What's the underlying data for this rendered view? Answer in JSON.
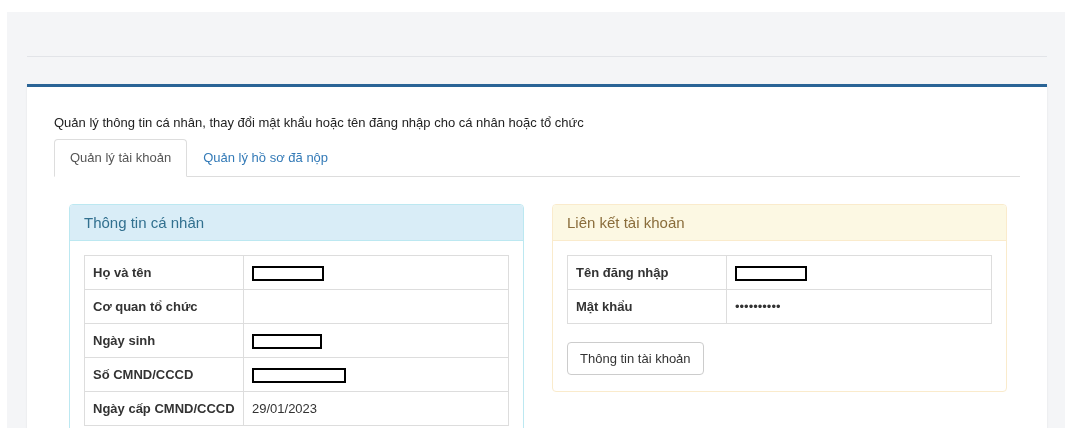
{
  "description": "Quản lý thông tin cá nhân, thay đổi mật khẩu hoặc tên đăng nhập cho cá nhân hoặc tổ chức",
  "tabs": [
    {
      "label": "Quản lý tài khoản",
      "selected": true
    },
    {
      "label": "Quản lý hồ sơ đã nộp",
      "selected": false
    }
  ],
  "personal_panel": {
    "title": "Thông tin cá nhân",
    "rows": [
      {
        "label": "Họ và tên",
        "kind": "redacted"
      },
      {
        "label": "Cơ quan tổ chức",
        "kind": "empty"
      },
      {
        "label": "Ngày sinh",
        "kind": "redacted"
      },
      {
        "label": "Số CMND/CCCD",
        "kind": "redacted"
      },
      {
        "label": "Ngày cấp CMND/CCCD",
        "kind": "text",
        "value": "29/01/2023"
      }
    ]
  },
  "account_panel": {
    "title": "Liên kết tài khoản",
    "rows": [
      {
        "label": "Tên đăng nhập",
        "kind": "redacted"
      },
      {
        "label": "Mật khẩu",
        "kind": "text",
        "value": "••••••••••"
      }
    ],
    "button": "Thông tin tài khoản"
  }
}
